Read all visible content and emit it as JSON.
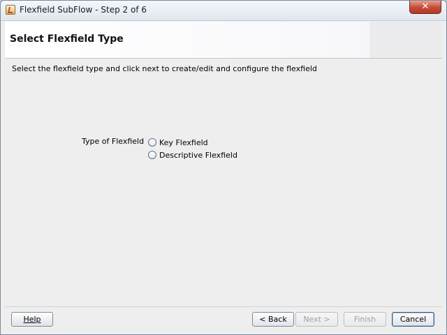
{
  "window": {
    "title": "Flexfield SubFlow - Step 2 of 6",
    "close_glyph": "✕"
  },
  "header": {
    "title": "Select Flexfield Type"
  },
  "content": {
    "instruction": "Select the flexfield type and click next to create/edit and configure the flexfield",
    "type_label": "Type of Flexfield",
    "options": [
      {
        "label": "Key Flexfield",
        "selected": false
      },
      {
        "label": "Descriptive Flexfield",
        "selected": false
      }
    ]
  },
  "buttons": {
    "help": "Help",
    "back": "< Back",
    "next": "Next >",
    "finish": "Finish",
    "cancel": "Cancel"
  }
}
